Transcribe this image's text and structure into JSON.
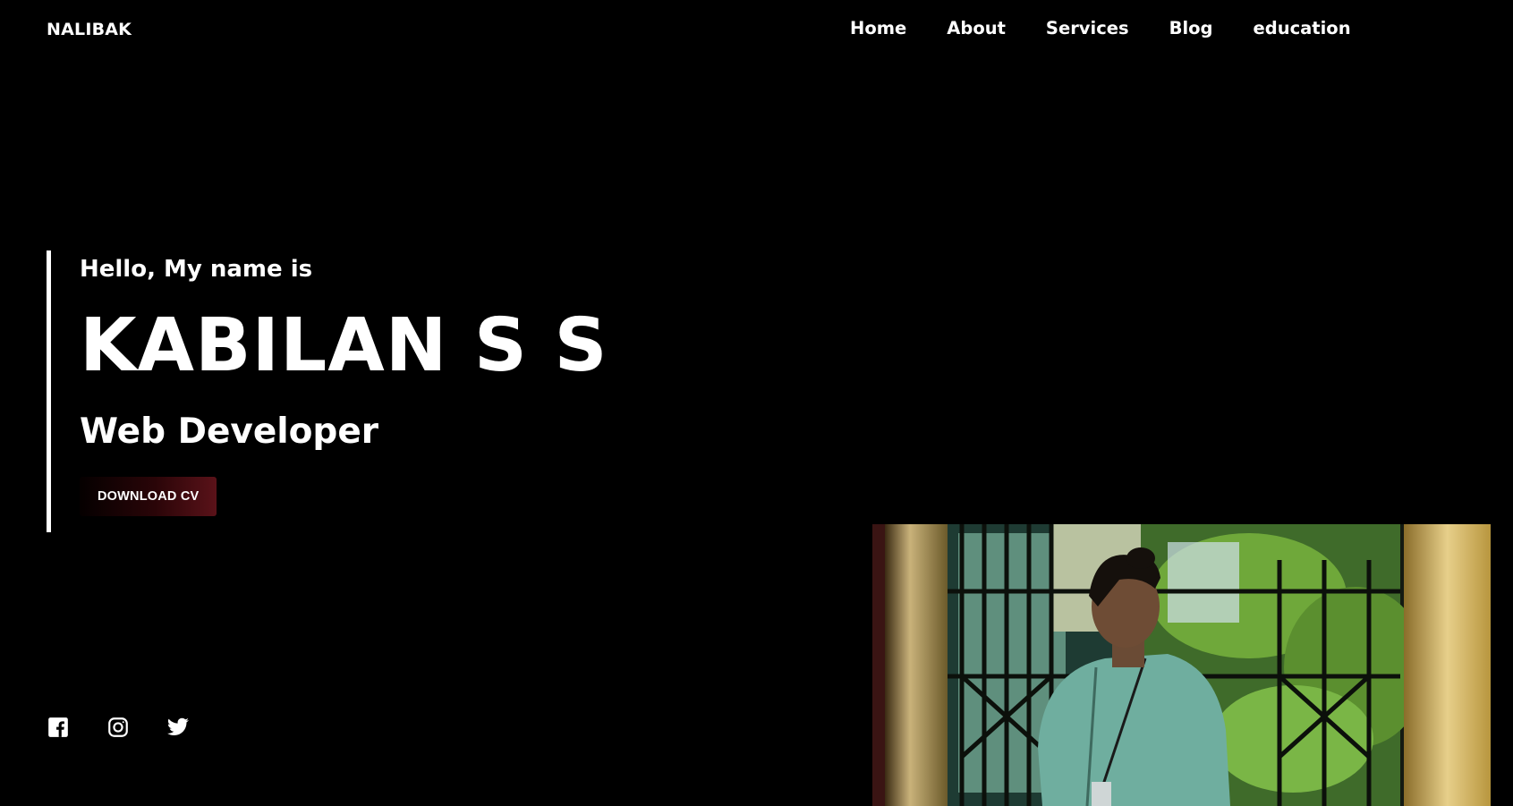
{
  "header": {
    "logo": "NALIBAK",
    "nav": [
      "Home",
      "About",
      "Services",
      "Blog",
      "education"
    ]
  },
  "hero": {
    "greeting": "Hello, My name is",
    "name": "KABILAN S S",
    "role": "Web Developer",
    "cta_label": "DOWNLOAD CV"
  },
  "social": {
    "icons": [
      "facebook-icon",
      "instagram-icon",
      "twitter-icon"
    ]
  },
  "colors": {
    "background": "#000000",
    "text": "#ffffff",
    "button_gradient_end": "#5a1219"
  }
}
